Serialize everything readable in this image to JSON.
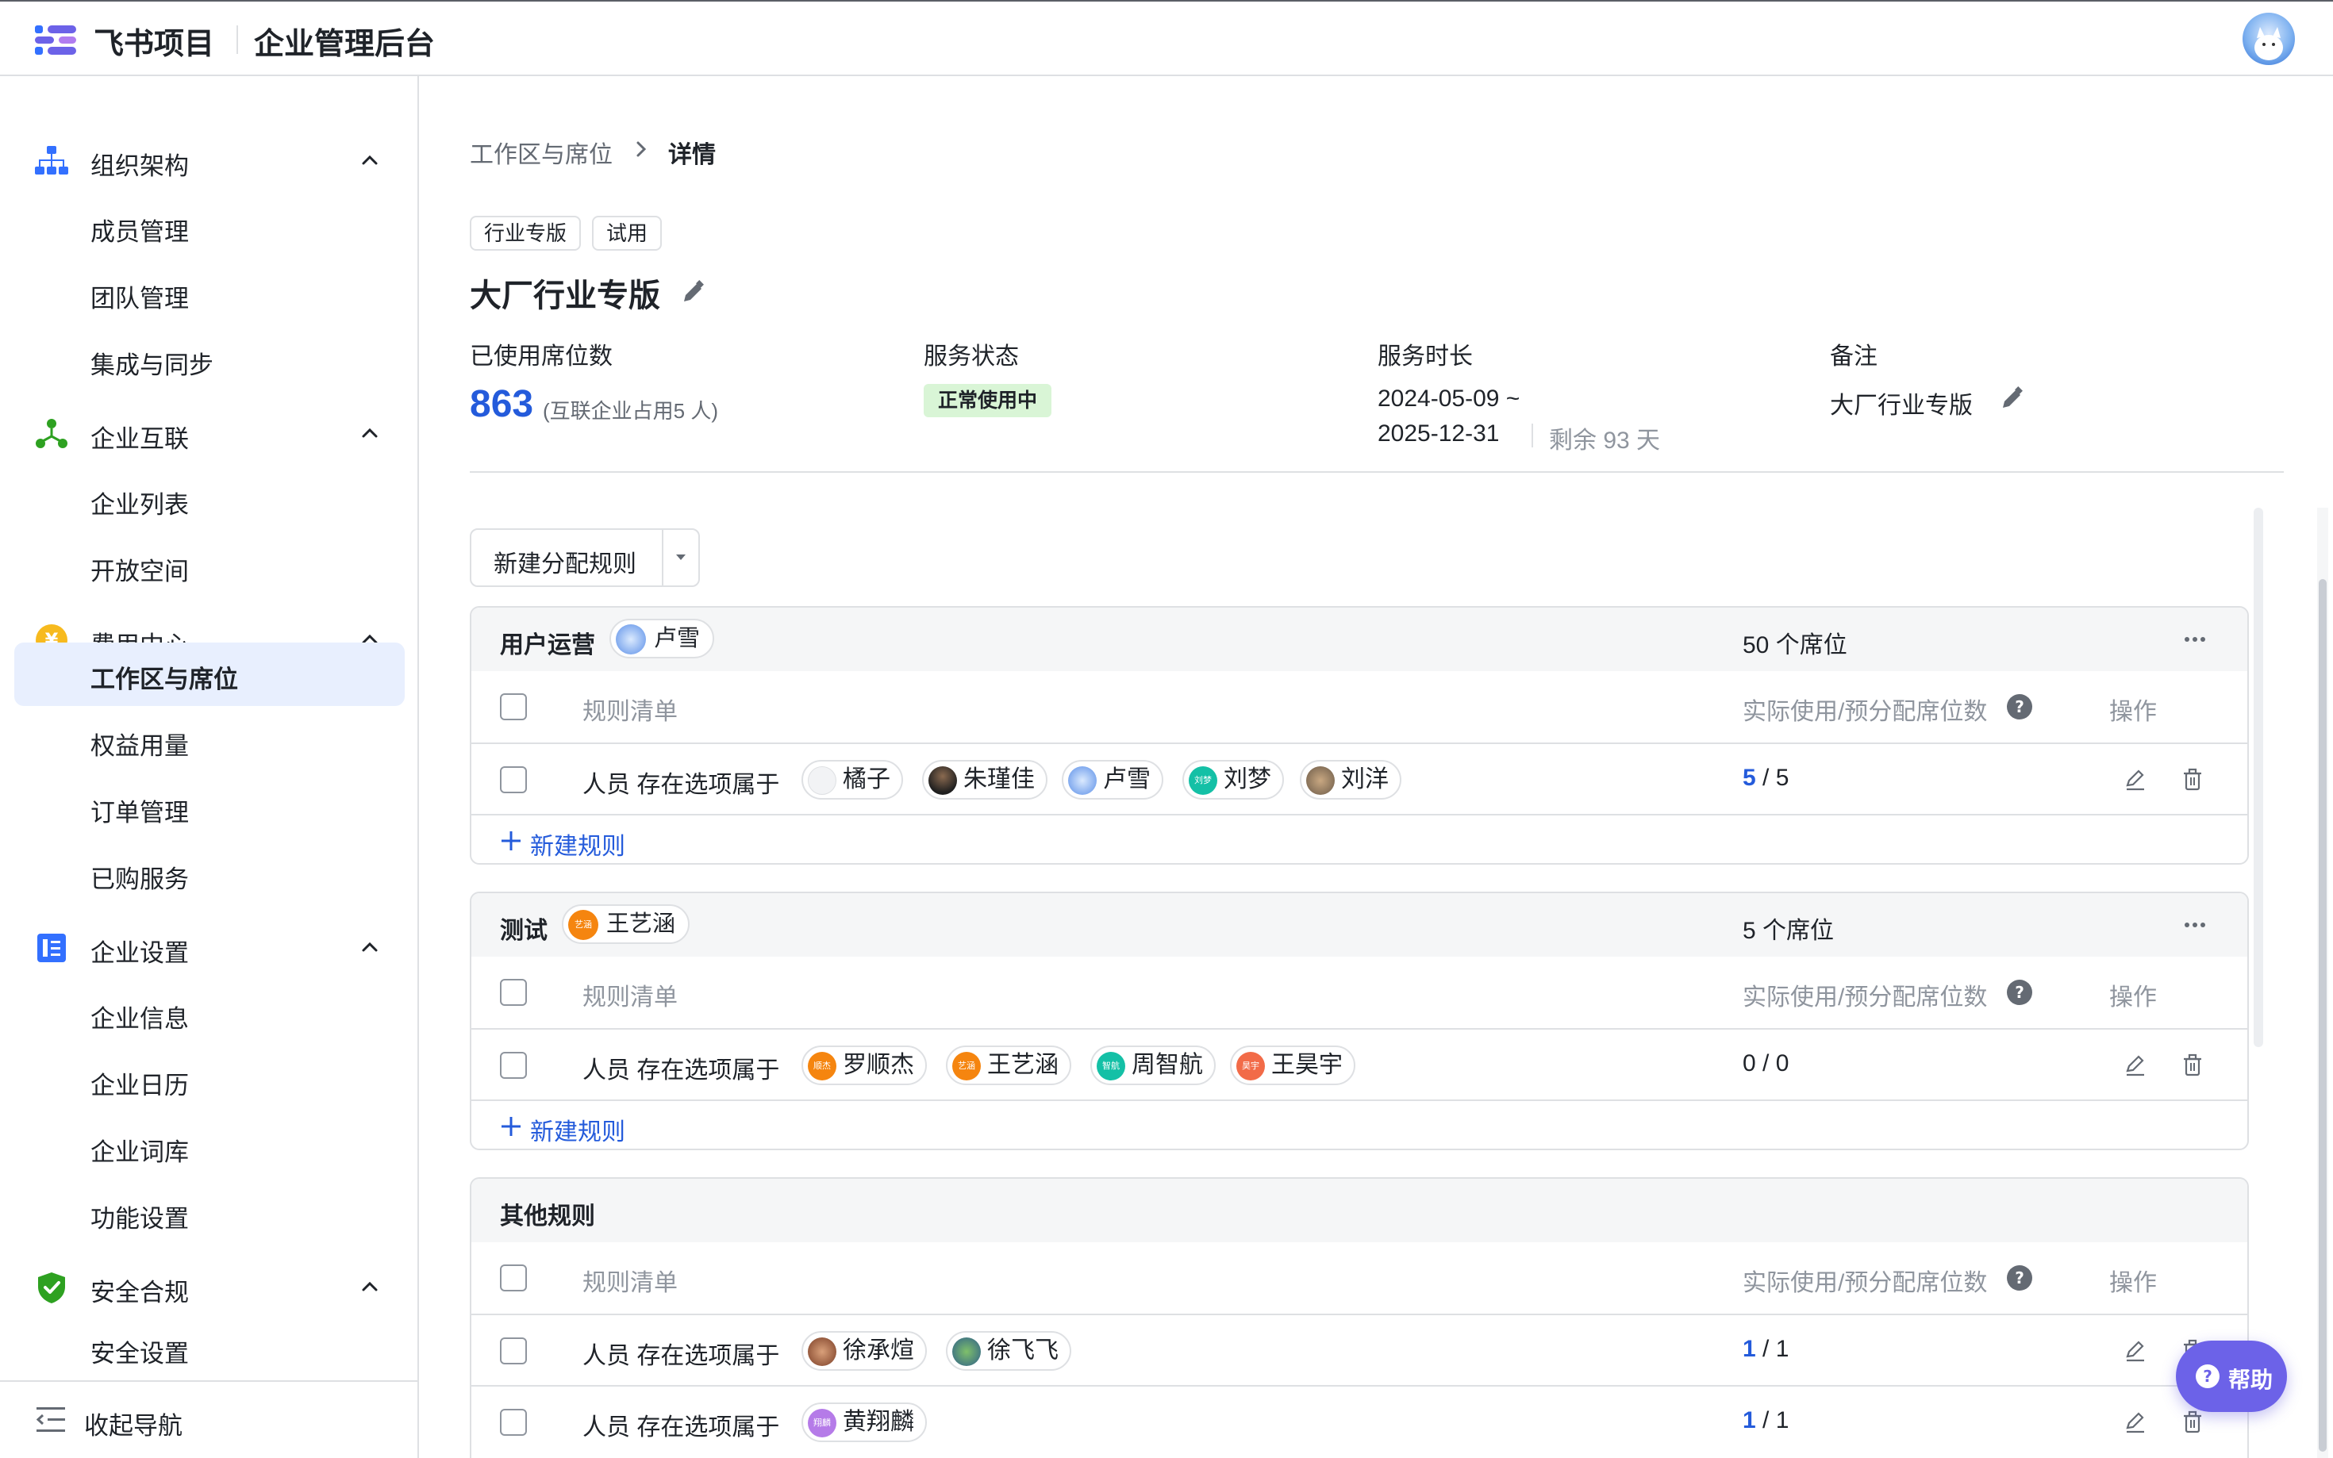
{
  "header": {
    "product": "飞书项目",
    "admin": "企业管理后台"
  },
  "sidebar": {
    "groups": [
      {
        "label": "组织架构",
        "items": [
          "成员管理",
          "团队管理",
          "集成与同步"
        ]
      },
      {
        "label": "企业互联",
        "items": [
          "企业列表",
          "开放空间"
        ]
      },
      {
        "label": "费用中心",
        "items": [
          "工作区与席位",
          "权益用量",
          "订单管理",
          "已购服务"
        ]
      },
      {
        "label": "企业设置",
        "items": [
          "企业信息",
          "企业日历",
          "企业词库",
          "功能设置"
        ]
      },
      {
        "label": "安全合规",
        "items": [
          "安全设置"
        ]
      }
    ],
    "collapse_label": "收起导航"
  },
  "breadcrumb": {
    "parent": "工作区与席位",
    "current": "详情"
  },
  "tags": [
    "行业专版",
    "试用"
  ],
  "title": "大厂行业专版",
  "stats": {
    "seats_label": "已使用席位数",
    "seats_value": "863",
    "seats_note": "(互联企业占用5 人)",
    "status_label": "服务状态",
    "status_value": "正常使用中",
    "duration_label": "服务时长",
    "date_start": "2024-05-09 ~",
    "date_end": "2025-12-31",
    "remaining": "剩余 93 天",
    "note_label": "备注",
    "note_value": "大厂行业专版"
  },
  "new_rule_button": "新建分配规则",
  "table_headers": {
    "rule": "规则清单",
    "usage": "实际使用/预分配席位数",
    "op": "操作"
  },
  "condition_prefix": "人员 存在选项属于",
  "add_rule_label": "新建规则",
  "cards": [
    {
      "name": "用户运营",
      "owner": "卢雪",
      "seats": "50 个席位",
      "rules": [
        {
          "members": [
            "橘子",
            "朱瑾佳",
            "卢雪",
            "刘梦",
            "刘洋"
          ],
          "used": "5",
          "total": " / 5"
        }
      ]
    },
    {
      "name": "测试",
      "owner": "王艺涵",
      "seats": "5 个席位",
      "rules": [
        {
          "members": [
            "罗顺杰",
            "王艺涵",
            "周智航",
            "王昊宇"
          ],
          "used": "0",
          "total": " / 0"
        }
      ]
    },
    {
      "name": "其他规则",
      "rules": [
        {
          "members": [
            "徐承煊",
            "徐飞飞"
          ],
          "used": "1",
          "total": " / 1"
        },
        {
          "members": [
            "黄翔麟"
          ],
          "used": "1",
          "total": " / 1"
        }
      ]
    }
  ],
  "avatar_initials": {
    "刘梦": "刘梦",
    "罗顺杰": "顺杰",
    "王艺涵": "艺涵",
    "周智航": "智航",
    "王昊宇": "昊宇",
    "黄翔麟": "翔麟"
  },
  "help_label": "帮助",
  "colors": {
    "accent": "#245bdb",
    "active_bg": "#e8effe",
    "status_bg": "#d9f5d6",
    "help_bg": "#6c62e8"
  }
}
